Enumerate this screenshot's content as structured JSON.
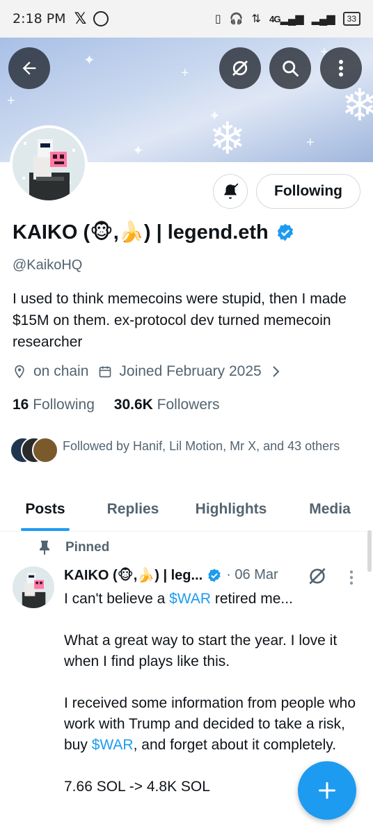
{
  "status_bar": {
    "time": "2:18 PM",
    "network": "4G",
    "battery": "33"
  },
  "header": {
    "back_label": "Back",
    "grok_label": "Grok",
    "search_label": "Search",
    "more_label": "More"
  },
  "profile": {
    "name": "KAIKO (🐵,🍌) | legend.eth",
    "handle": "@KaikoHQ",
    "bio": "I used to think memecoins were stupid, then I made $15M on them.  ex-protocol dev turned memecoin researcher",
    "location": "on chain",
    "joined": "Joined February 2025",
    "following_count": "16",
    "following_label": "Following",
    "followers_count": "30.6K",
    "followers_label": "Followers",
    "followed_by": "Followed by Hanif, Lil Motion, Mr X, and 43 others",
    "follow_button": "Following"
  },
  "tabs": [
    {
      "label": "Posts",
      "active": true
    },
    {
      "label": "Replies",
      "active": false
    },
    {
      "label": "Highlights",
      "active": false
    },
    {
      "label": "Media",
      "active": false
    }
  ],
  "tweet": {
    "pinned_label": "Pinned",
    "author": "KAIKO (🐵,🍌) | leg...",
    "date": "· 06 Mar",
    "line1_pre": "I can't believe a ",
    "line1_cash": "$WAR",
    "line1_post": " retired me...",
    "para2": "What a great way to start the year. I love it when I find plays like this.",
    "para3_pre": "I received some information from people who work with Trump and decided to take a risk, buy ",
    "para3_cash": "$WAR",
    "para3_post": ", and forget about it completely.",
    "para4": "7.66 SOL -> 4.8K SOL"
  },
  "colors": {
    "accent": "#1d9bf0",
    "text": "#0f1419",
    "muted": "#536471"
  }
}
